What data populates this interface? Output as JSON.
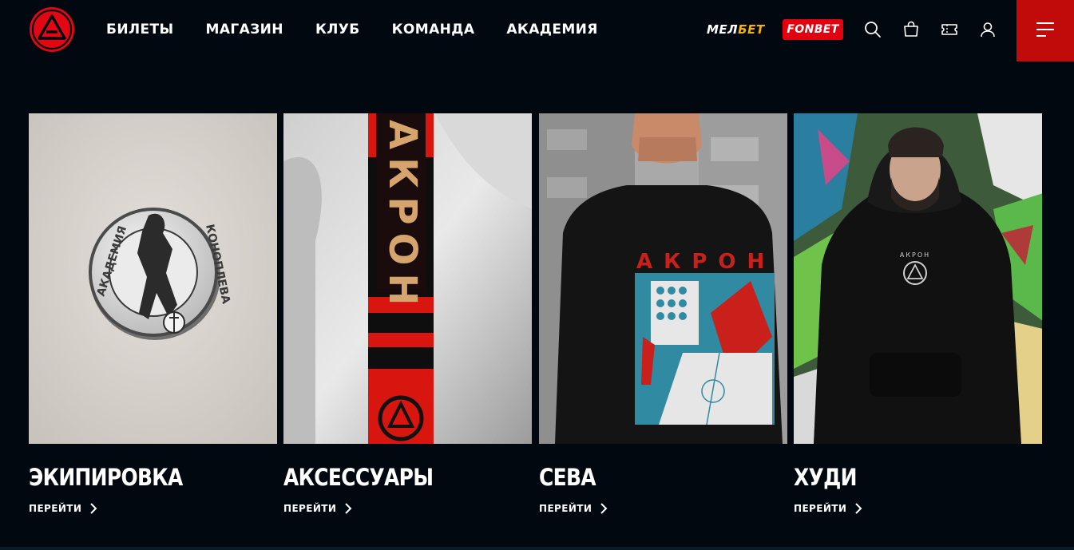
{
  "header": {
    "nav": [
      {
        "label": "БИЛЕТЫ"
      },
      {
        "label": "МАГАЗИН"
      },
      {
        "label": "КЛУБ"
      },
      {
        "label": "КОМАНДА"
      },
      {
        "label": "АКАДЕМИЯ"
      }
    ],
    "sponsors": {
      "melbet_part1": "МЕЛ",
      "melbet_part2": "БЕТ",
      "fonbet": "FONBET"
    },
    "icons": [
      "search-icon",
      "cart-icon",
      "ticket-icon",
      "user-icon",
      "menu-icon"
    ]
  },
  "colors": {
    "background": "#02080f",
    "accent_red": "#c10a0a",
    "fonbet_red": "#e3000f",
    "melbet_yellow": "#f5b400",
    "text": "#ffffff"
  },
  "cards": [
    {
      "title": "ЭКИПИРОВКА",
      "link_label": "ПЕРЕЙТИ"
    },
    {
      "title": "АКСЕССУАРЫ",
      "link_label": "ПЕРЕЙТИ"
    },
    {
      "title": "СЕВА",
      "link_label": "ПЕРЕЙТИ"
    },
    {
      "title": "ХУДИ",
      "link_label": "ПЕРЕЙТИ"
    }
  ],
  "images": {
    "scarf_text": "АКРОН",
    "sweatshirt_text": "АКРОН",
    "badge_text_left": "АКАДЕМИЯ",
    "badge_text_right": "КОНОПЛЕВА",
    "hoodie_print": "АКРОН"
  }
}
